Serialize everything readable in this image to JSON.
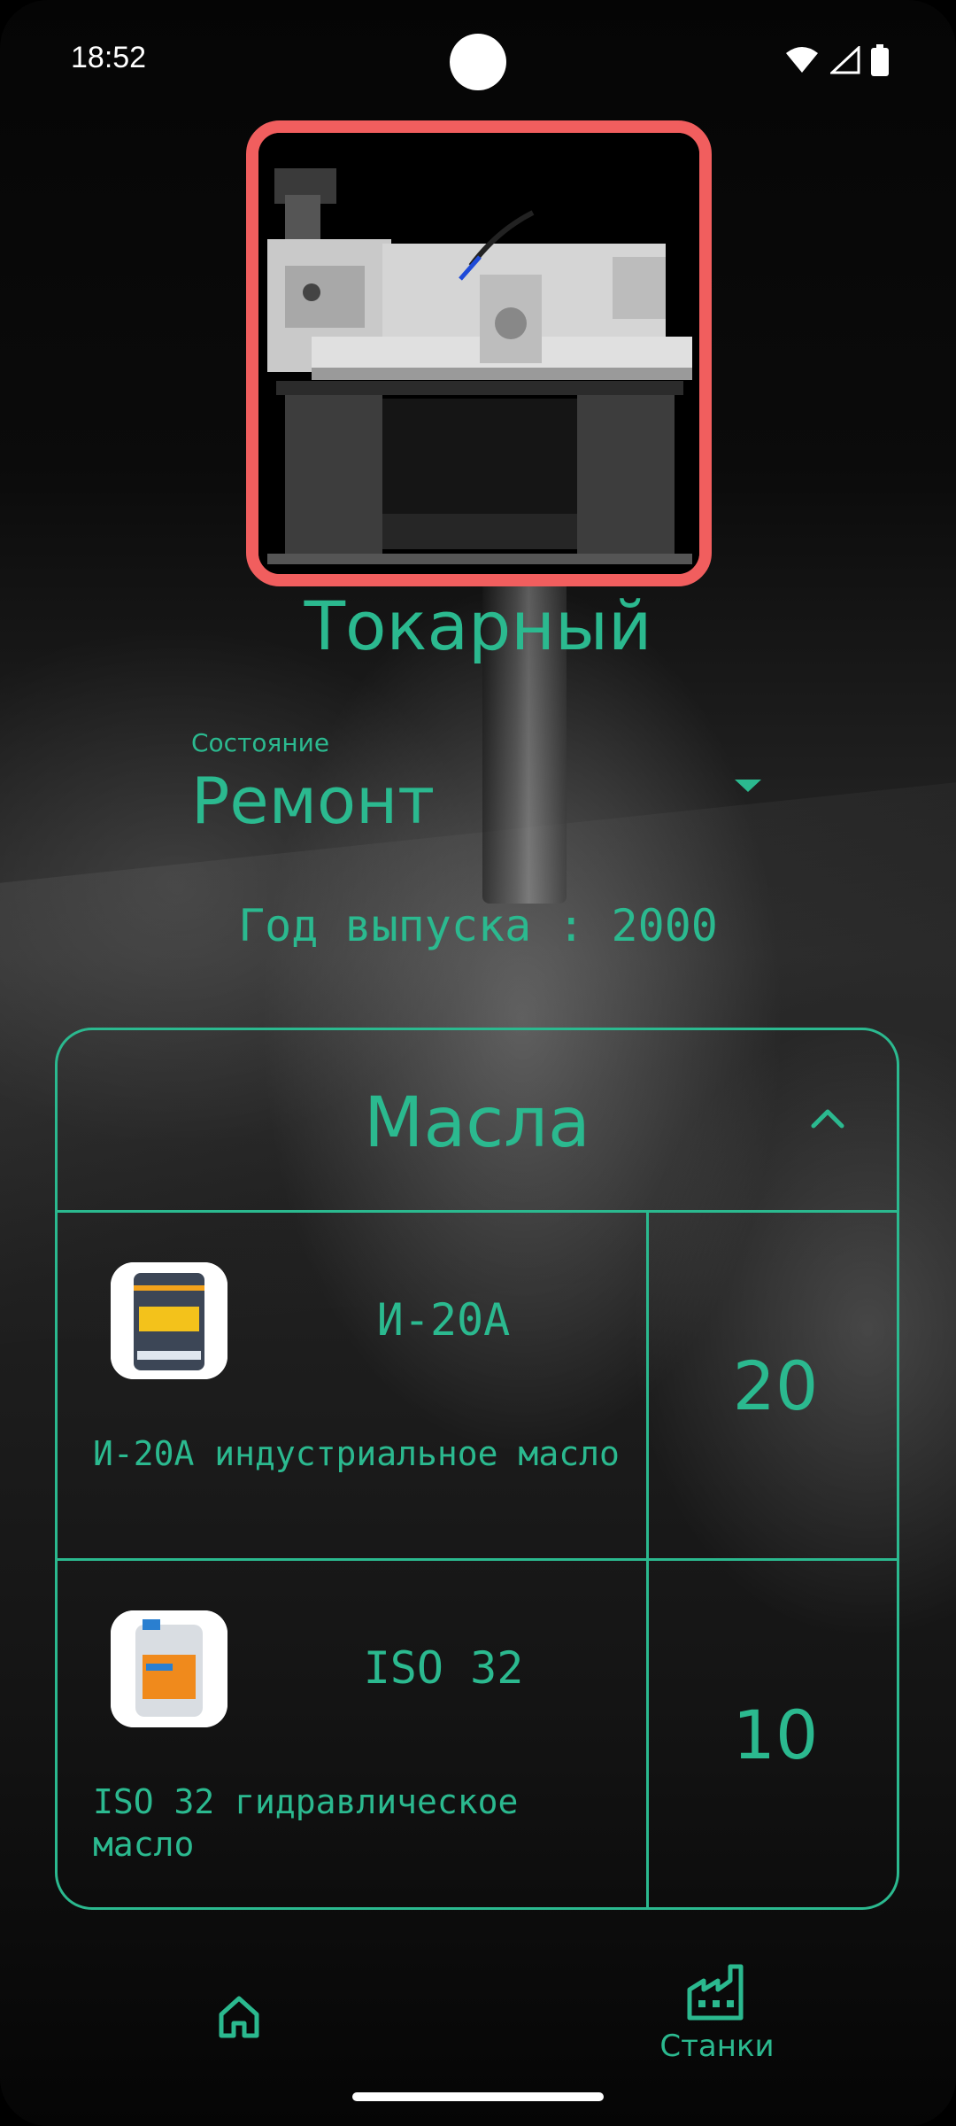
{
  "status_bar": {
    "time": "18:52",
    "icons": [
      "wifi-icon",
      "cell-signal-icon",
      "battery-icon"
    ]
  },
  "machine": {
    "name": "Токарный",
    "photo": "lathe-machine-photo",
    "state_label": "Состояние",
    "state_value": "Ремонт",
    "year_text": "Год выпуска : 2000"
  },
  "oils": {
    "title": "Масла",
    "items": [
      {
        "name": "И-20А",
        "description": "И-20А индустриальное масло",
        "quantity": "20",
        "thumb": "oil-barrel-thumb"
      },
      {
        "name": "ISO 32",
        "description": "ISO 32 гидравлическое масло",
        "quantity": "10",
        "thumb": "oil-canister-thumb"
      }
    ]
  },
  "bottom_nav": {
    "home_icon": "home-icon",
    "machines_icon": "factory-icon",
    "machines_label": "Станки"
  },
  "colors": {
    "accent": "#2bb98f",
    "photo_border": "#f15e5e",
    "background": "#000000"
  }
}
